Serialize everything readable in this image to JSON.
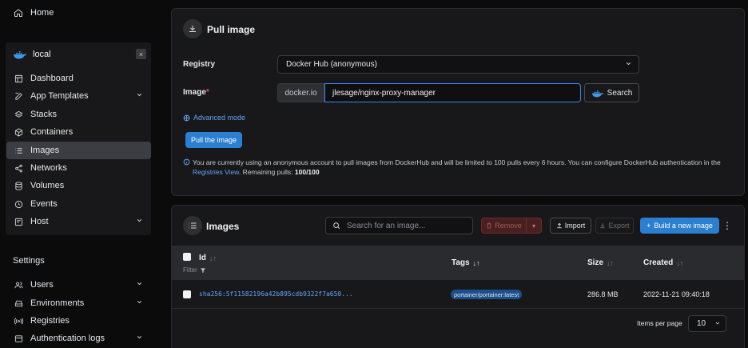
{
  "sidebar": {
    "home": "Home",
    "environment": {
      "name": "local",
      "close": "×"
    },
    "env_items": [
      {
        "label": "Dashboard",
        "icon": "dashboard-icon"
      },
      {
        "label": "App Templates",
        "icon": "edit-icon",
        "expandable": true
      },
      {
        "label": "Stacks",
        "icon": "stacks-icon"
      },
      {
        "label": "Containers",
        "icon": "containers-icon"
      },
      {
        "label": "Images",
        "icon": "list-icon",
        "active": true
      },
      {
        "label": "Networks",
        "icon": "share-icon"
      },
      {
        "label": "Volumes",
        "icon": "database-icon"
      },
      {
        "label": "Events",
        "icon": "clock-icon"
      },
      {
        "label": "Host",
        "icon": "server-icon",
        "expandable": true
      }
    ],
    "settings_title": "Settings",
    "settings_items": [
      {
        "label": "Users",
        "icon": "users-icon",
        "expandable": true
      },
      {
        "label": "Environments",
        "icon": "drive-icon",
        "expandable": true
      },
      {
        "label": "Registries",
        "icon": "radio-icon"
      },
      {
        "label": "Authentication logs",
        "icon": "log-icon",
        "expandable": true
      }
    ]
  },
  "pull": {
    "title": "Pull image",
    "registry_label": "Registry",
    "registry_value": "Docker Hub (anonymous)",
    "image_label": "Image",
    "image_required": "*",
    "image_prefix": "docker.io",
    "image_value": "jlesage/nginx-proxy-manager",
    "search_label": "Search",
    "advanced_mode": "Advanced mode",
    "pull_button": "Pull the image",
    "info_text": "You are currently using an anonymous account to pull images from DockerHub and will be limited to 100 pulls every 6 hours. You can configure DockerHub authentication in the",
    "info_link": "Registries View",
    "info_remaining": ". Remaining pulls:",
    "info_count": "100/100"
  },
  "images": {
    "title": "Images",
    "search_placeholder": "Search for an image...",
    "remove": "Remove",
    "import": "Import",
    "export": "Export",
    "build": "Build a new image",
    "columns": {
      "id": "Id",
      "filter": "Filter",
      "tags": "Tags",
      "size": "Size",
      "created": "Created"
    },
    "rows": [
      {
        "id": "sha256:5f11582196a42b895cdb9322f7a650...",
        "tag": "portainer/portainer:latest",
        "size": "286.8 MB",
        "created": "2022-11-21 09:40:18"
      }
    ],
    "items_per_page_label": "Items per page",
    "items_per_page": "10"
  },
  "colors": {
    "accent": "#2b7fd1",
    "link": "#60a5fa",
    "danger": "#6b2a2a"
  }
}
